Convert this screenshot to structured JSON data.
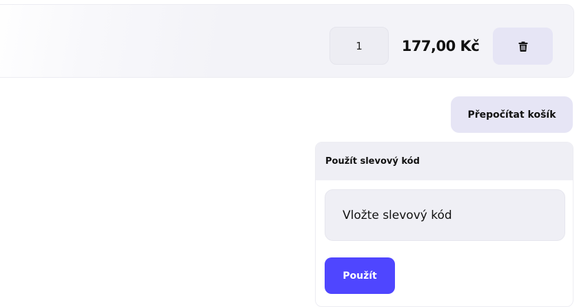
{
  "cart_item": {
    "quantity": "1",
    "price": "177,00 Kč",
    "delete_icon": "trash-icon"
  },
  "cart_actions": {
    "recalculate_label": "Přepočítat košík"
  },
  "coupon": {
    "title": "Použít slevový kód",
    "input_placeholder": "Vložte slevový kód",
    "input_value": "",
    "apply_label": "Použít"
  },
  "colors": {
    "accent": "#4f46ff",
    "soft_button": "#e6e5f5",
    "panel_bg": "#efeff5"
  }
}
